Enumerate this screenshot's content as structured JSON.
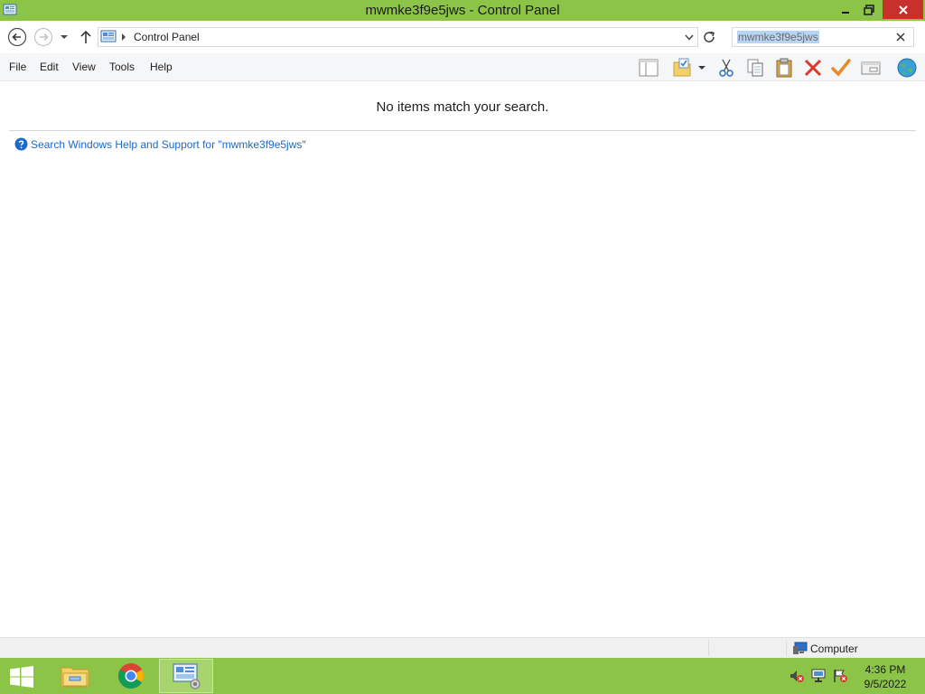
{
  "window": {
    "title": "mwmke3f9e5jws - Control Panel"
  },
  "address": {
    "location": "Control Panel"
  },
  "search": {
    "query": "mwmke3f9e5jws"
  },
  "menu": {
    "file": "File",
    "edit": "Edit",
    "view": "View",
    "tools": "Tools",
    "help": "Help"
  },
  "toolbar_icons": [
    "layout-pane-icon",
    "folder-options-icon",
    "dropdown-icon",
    "cut-icon",
    "copy-icon",
    "paste-icon",
    "delete-icon",
    "checkmark-icon",
    "properties-icon",
    "globe-icon"
  ],
  "content": {
    "empty_message": "No items match your search.",
    "help_link": "Search Windows Help and Support for \"mwmke3f9e5jws\""
  },
  "status": {
    "location": "Computer"
  },
  "taskbar": {
    "items": [
      "windows-start-icon",
      "file-explorer-icon",
      "chrome-icon",
      "control-panel-icon"
    ],
    "time": "4:36 PM",
    "date": "9/5/2022"
  },
  "colors": {
    "accent": "#8cc447",
    "close_button": "#c7302b",
    "link": "#1b6ac9",
    "selection": "#b7d4f4"
  }
}
